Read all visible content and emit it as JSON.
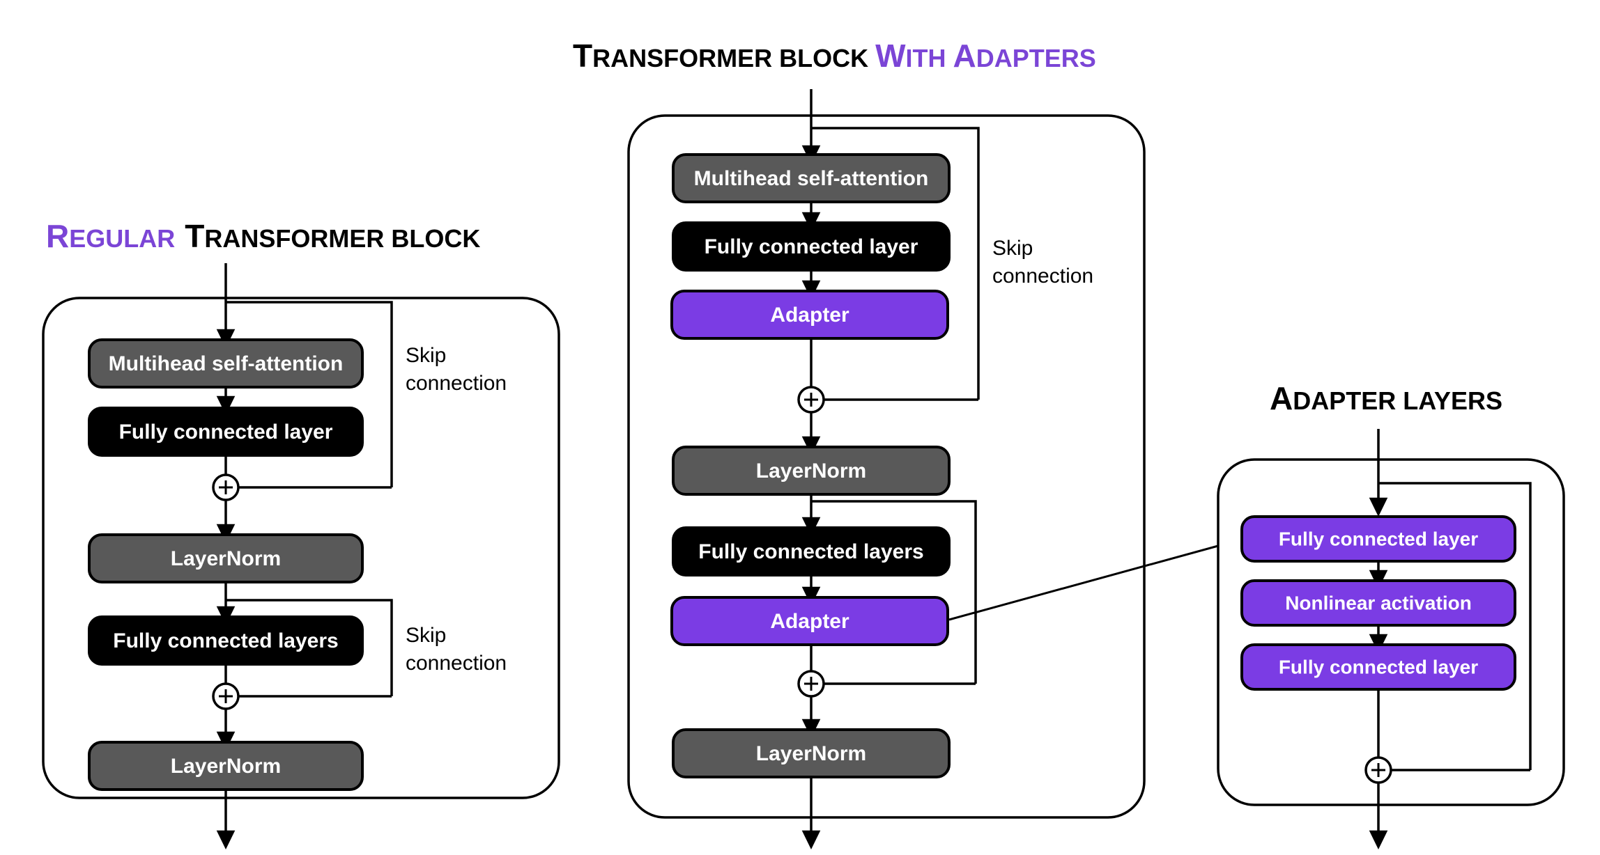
{
  "figure": {
    "background_color": "#ffffff",
    "accent_color": "#7b45d6",
    "adapter_color": "#7b3ce4",
    "gray_color": "#595959",
    "black_color": "#000000"
  },
  "panels": {
    "left": {
      "title": {
        "accent_word": "Regular",
        "accent_lead": "R",
        "accent_rest": "EGULAR",
        "plain_lead": "T",
        "plain_rest": "RANSFORMER BLOCK",
        "full": "REGULAR TRANSFORMER BLOCK"
      },
      "nodes": [
        {
          "label": "Multihead self-attention",
          "style": "gray"
        },
        {
          "label": "Fully connected layer",
          "style": "black"
        },
        {
          "label": "LayerNorm",
          "style": "gray"
        },
        {
          "label": "Fully connected layers",
          "style": "black"
        },
        {
          "label": "LayerNorm",
          "style": "gray"
        }
      ],
      "skip_labels": [
        {
          "line1": "Skip",
          "line2": "connection"
        },
        {
          "line1": "Skip",
          "line2": "connection"
        }
      ],
      "add_symbol": "+"
    },
    "middle": {
      "title": {
        "plain_lead": "T",
        "plain_rest": "RANSFORMER BLOCK ",
        "accent_lead_1": "W",
        "accent_rest_1": "ITH ",
        "accent_lead_2": "A",
        "accent_rest_2": "DAPTERS",
        "full": "TRANSFORMER BLOCK WITH ADAPTERS"
      },
      "nodes": [
        {
          "label": "Multihead self-attention",
          "style": "gray"
        },
        {
          "label": "Fully connected layer",
          "style": "black"
        },
        {
          "label": "Adapter",
          "style": "purple"
        },
        {
          "label": "LayerNorm",
          "style": "gray"
        },
        {
          "label": "Fully connected layers",
          "style": "black"
        },
        {
          "label": "Adapter",
          "style": "purple"
        },
        {
          "label": "LayerNorm",
          "style": "gray"
        }
      ],
      "skip_labels": [
        {
          "line1": "Skip",
          "line2": "connection"
        }
      ],
      "add_symbol": "+"
    },
    "right": {
      "title": {
        "plain_lead": "A",
        "plain_rest": "DAPTER LAYERS",
        "full": "ADAPTER LAYERS"
      },
      "nodes": [
        {
          "label": "Fully connected layer",
          "style": "purple"
        },
        {
          "label": "Nonlinear activation",
          "style": "purple"
        },
        {
          "label": "Fully connected layer",
          "style": "purple"
        }
      ],
      "add_symbol": "+"
    }
  }
}
